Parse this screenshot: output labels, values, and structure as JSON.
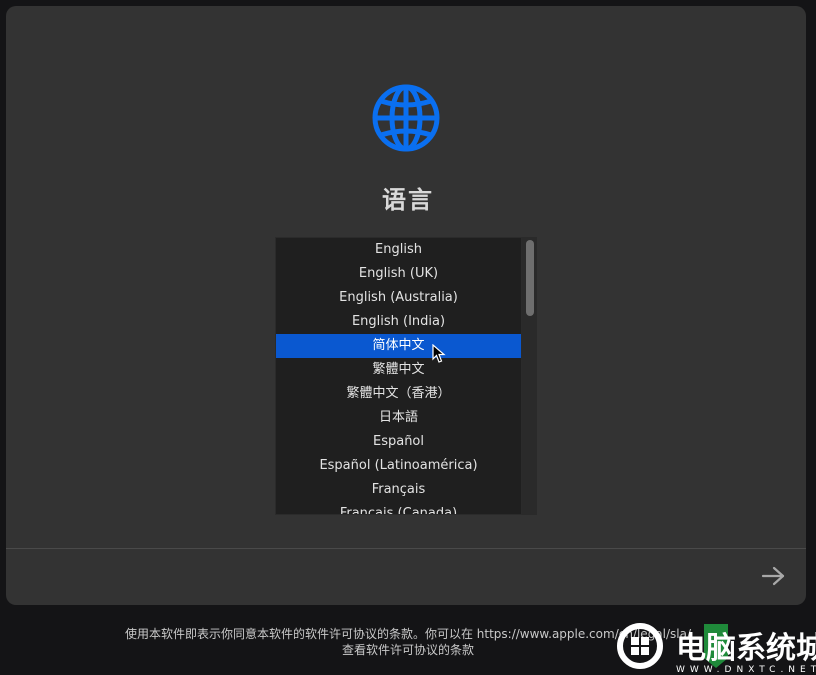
{
  "page": {
    "title": "语言",
    "icon": "globe-icon",
    "accent_color": "#0a6ff0",
    "selection_color": "#0a58d0"
  },
  "languages": [
    {
      "label": "English",
      "selected": false
    },
    {
      "label": "English (UK)",
      "selected": false
    },
    {
      "label": "English (Australia)",
      "selected": false
    },
    {
      "label": "English (India)",
      "selected": false
    },
    {
      "label": "简体中文",
      "selected": true
    },
    {
      "label": "繁體中文",
      "selected": false
    },
    {
      "label": "繁體中文（香港）",
      "selected": false
    },
    {
      "label": "日本語",
      "selected": false
    },
    {
      "label": "Español",
      "selected": false
    },
    {
      "label": "Español (Latinoamérica)",
      "selected": false
    },
    {
      "label": "Français",
      "selected": false
    },
    {
      "label": "Français (Canada)",
      "selected": false
    }
  ],
  "navigation": {
    "next_icon": "arrow-right-icon"
  },
  "footer": {
    "line1": "使用本软件即表示你同意本软件的软件许可协议的条款。你可以在 https://www.apple.com/cn/legal/sla/",
    "line2": "查看软件许可协议的条款"
  },
  "watermark": {
    "text": "电脑系统城",
    "subtext": "WWW.DNXTC.NET"
  }
}
